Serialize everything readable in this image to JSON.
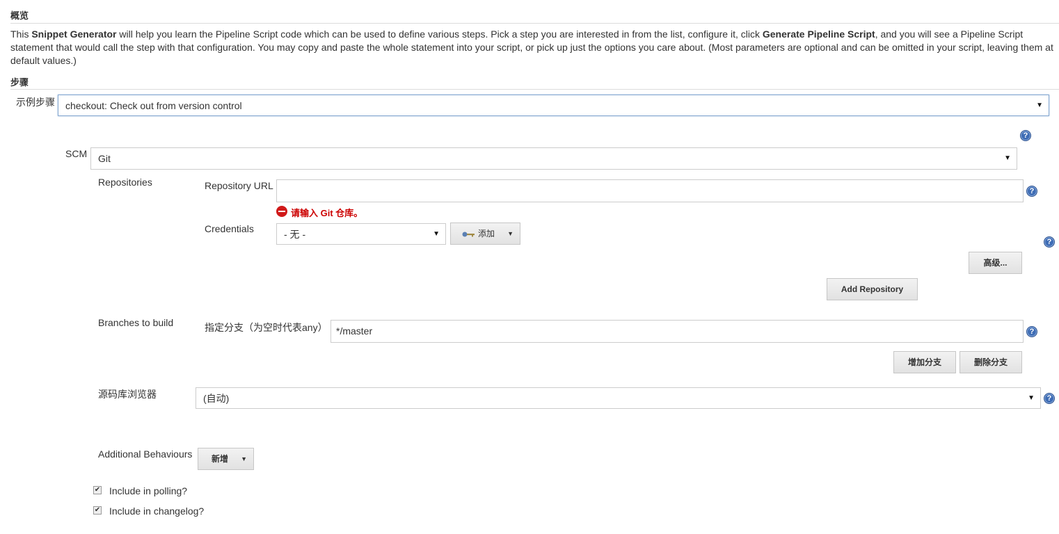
{
  "overview": {
    "title": "概览",
    "desc_1": "This ",
    "desc_bold_1": "Snippet Generator",
    "desc_2": " will help you learn the Pipeline Script code which can be used to define various steps. Pick a step you are interested in from the list, configure it, click ",
    "desc_bold_2": "Generate Pipeline Script",
    "desc_3": ", and you will see a Pipeline Script statement that would call the step with that configuration. You may copy and paste the whole statement into your script, or pick up just the options you care about. (Most parameters are optional and can be omitted in your script, leaving them at default values.)"
  },
  "steps": {
    "title": "步骤",
    "sample_step_label": "示例步骤",
    "sample_step_value": "checkout: Check out from version control"
  },
  "scm": {
    "label": "SCM",
    "value": "Git",
    "repositories_label": "Repositories",
    "repo_url_label": "Repository URL",
    "repo_url_value": "",
    "repo_url_error": "请输入 Git 仓库。",
    "credentials_label": "Credentials",
    "credentials_value": "- 无 -",
    "add_label": "添加",
    "advanced_label": "高级...",
    "add_repository_label": "Add Repository",
    "branches_label": "Branches to build",
    "branch_spec_label": "指定分支（为空时代表any）",
    "branch_spec_value": "*/master",
    "add_branch_label": "增加分支",
    "delete_branch_label": "删除分支",
    "browser_label": "源码库浏览器",
    "browser_value": "(自动)",
    "additional_behaviours_label": "Additional Behaviours",
    "new_label": "新增",
    "include_polling_label": "Include in polling?",
    "include_polling_checked": true,
    "include_changelog_label": "Include in changelog?",
    "include_changelog_checked": true
  },
  "icons": {
    "help": "help-icon",
    "dropdown": "chevron-down-icon",
    "error": "error-icon",
    "key": "key-icon"
  },
  "colors": {
    "help_blue": "#3f6db5",
    "error_red": "#c00000"
  }
}
